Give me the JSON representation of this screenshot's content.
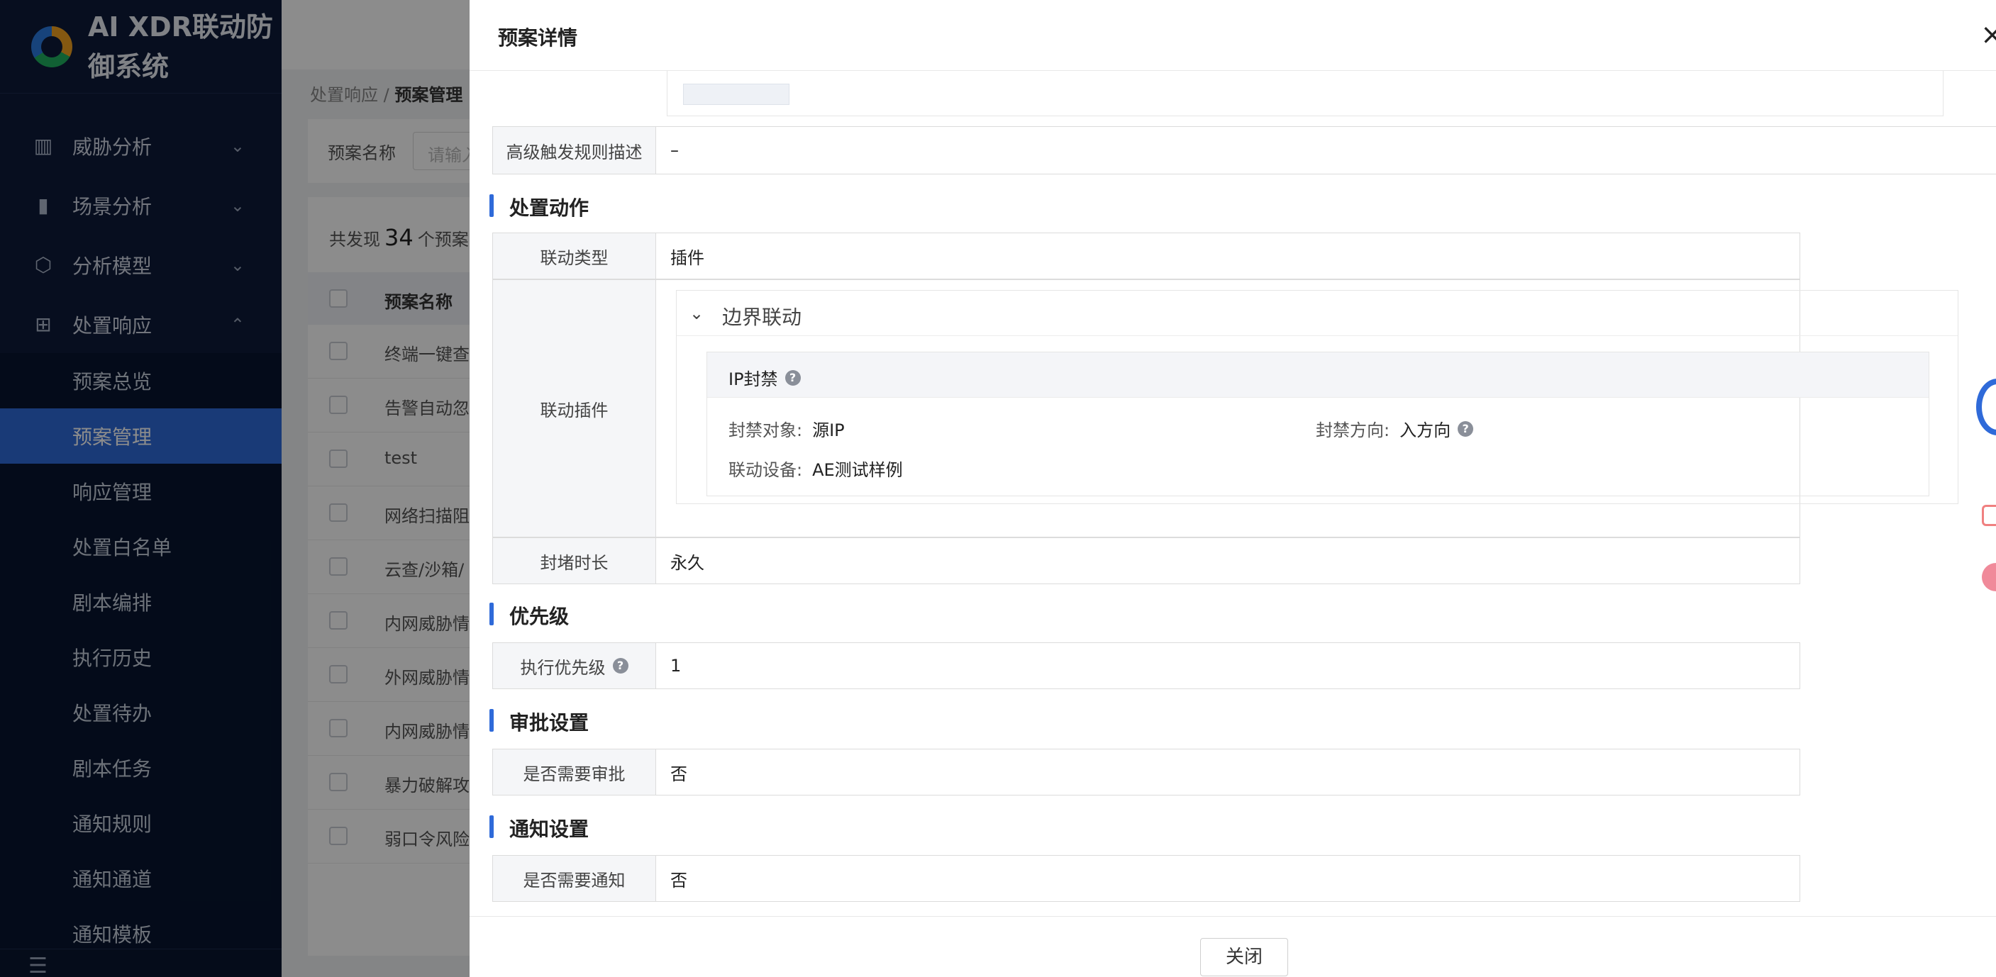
{
  "app": {
    "title": "AI XDR联动防御系统"
  },
  "sidebar": {
    "groups": [
      {
        "label": "威胁分析",
        "icon": "chart-icon"
      },
      {
        "label": "场景分析",
        "icon": "bookmark-icon"
      },
      {
        "label": "分析模型",
        "icon": "cube-icon"
      },
      {
        "label": "处置响应",
        "icon": "sitemap-icon"
      }
    ],
    "sub_items": [
      "预案总览",
      "预案管理",
      "响应管理",
      "处置白名单",
      "剧本编排",
      "执行历史",
      "处置待办",
      "剧本任务",
      "通知规则",
      "通知通道",
      "通知模板"
    ],
    "active_sub": "预案管理"
  },
  "background": {
    "breadcrumb": {
      "parent": "处置响应 /",
      "current": "预案管理"
    },
    "filter": {
      "label": "预案名称",
      "placeholder": "请输入"
    },
    "count": {
      "prefix": "共发现",
      "number": "34",
      "suffix": "个预案"
    },
    "table_header": "预案名称",
    "rows": [
      "终端一键查",
      "告警自动忽",
      "test",
      "网络扫描阻",
      "云查/沙箱/",
      "内网威胁情",
      "外网威胁情",
      "内网威胁情",
      "暴力破解攻",
      "弱口令风险"
    ]
  },
  "drawer": {
    "title": "预案详情",
    "close_icon": "×",
    "advanced_rule": {
      "label": "高级触发规则描述",
      "value": "–"
    },
    "action_section": "处置动作",
    "link_type": {
      "label": "联动类型",
      "value": "插件"
    },
    "link_plugin": {
      "label": "联动插件",
      "group_title": "边界联动",
      "card_title": "IP封禁",
      "fields": {
        "target_label": "封禁对象:",
        "target_value": "源IP",
        "direction_label": "封禁方向:",
        "direction_value": "入方向",
        "device_label": "联动设备:",
        "device_value": "AE测试样例"
      }
    },
    "block_duration": {
      "label": "封堵时长",
      "value": "永久"
    },
    "priority_section": "优先级",
    "priority": {
      "label": "执行优先级",
      "value": "1"
    },
    "approval_section": "审批设置",
    "approval": {
      "label": "是否需要审批",
      "value": "否"
    },
    "notify_section": "通知设置",
    "notify": {
      "label": "是否需要通知",
      "value": "否"
    },
    "footer_button": "关闭"
  }
}
